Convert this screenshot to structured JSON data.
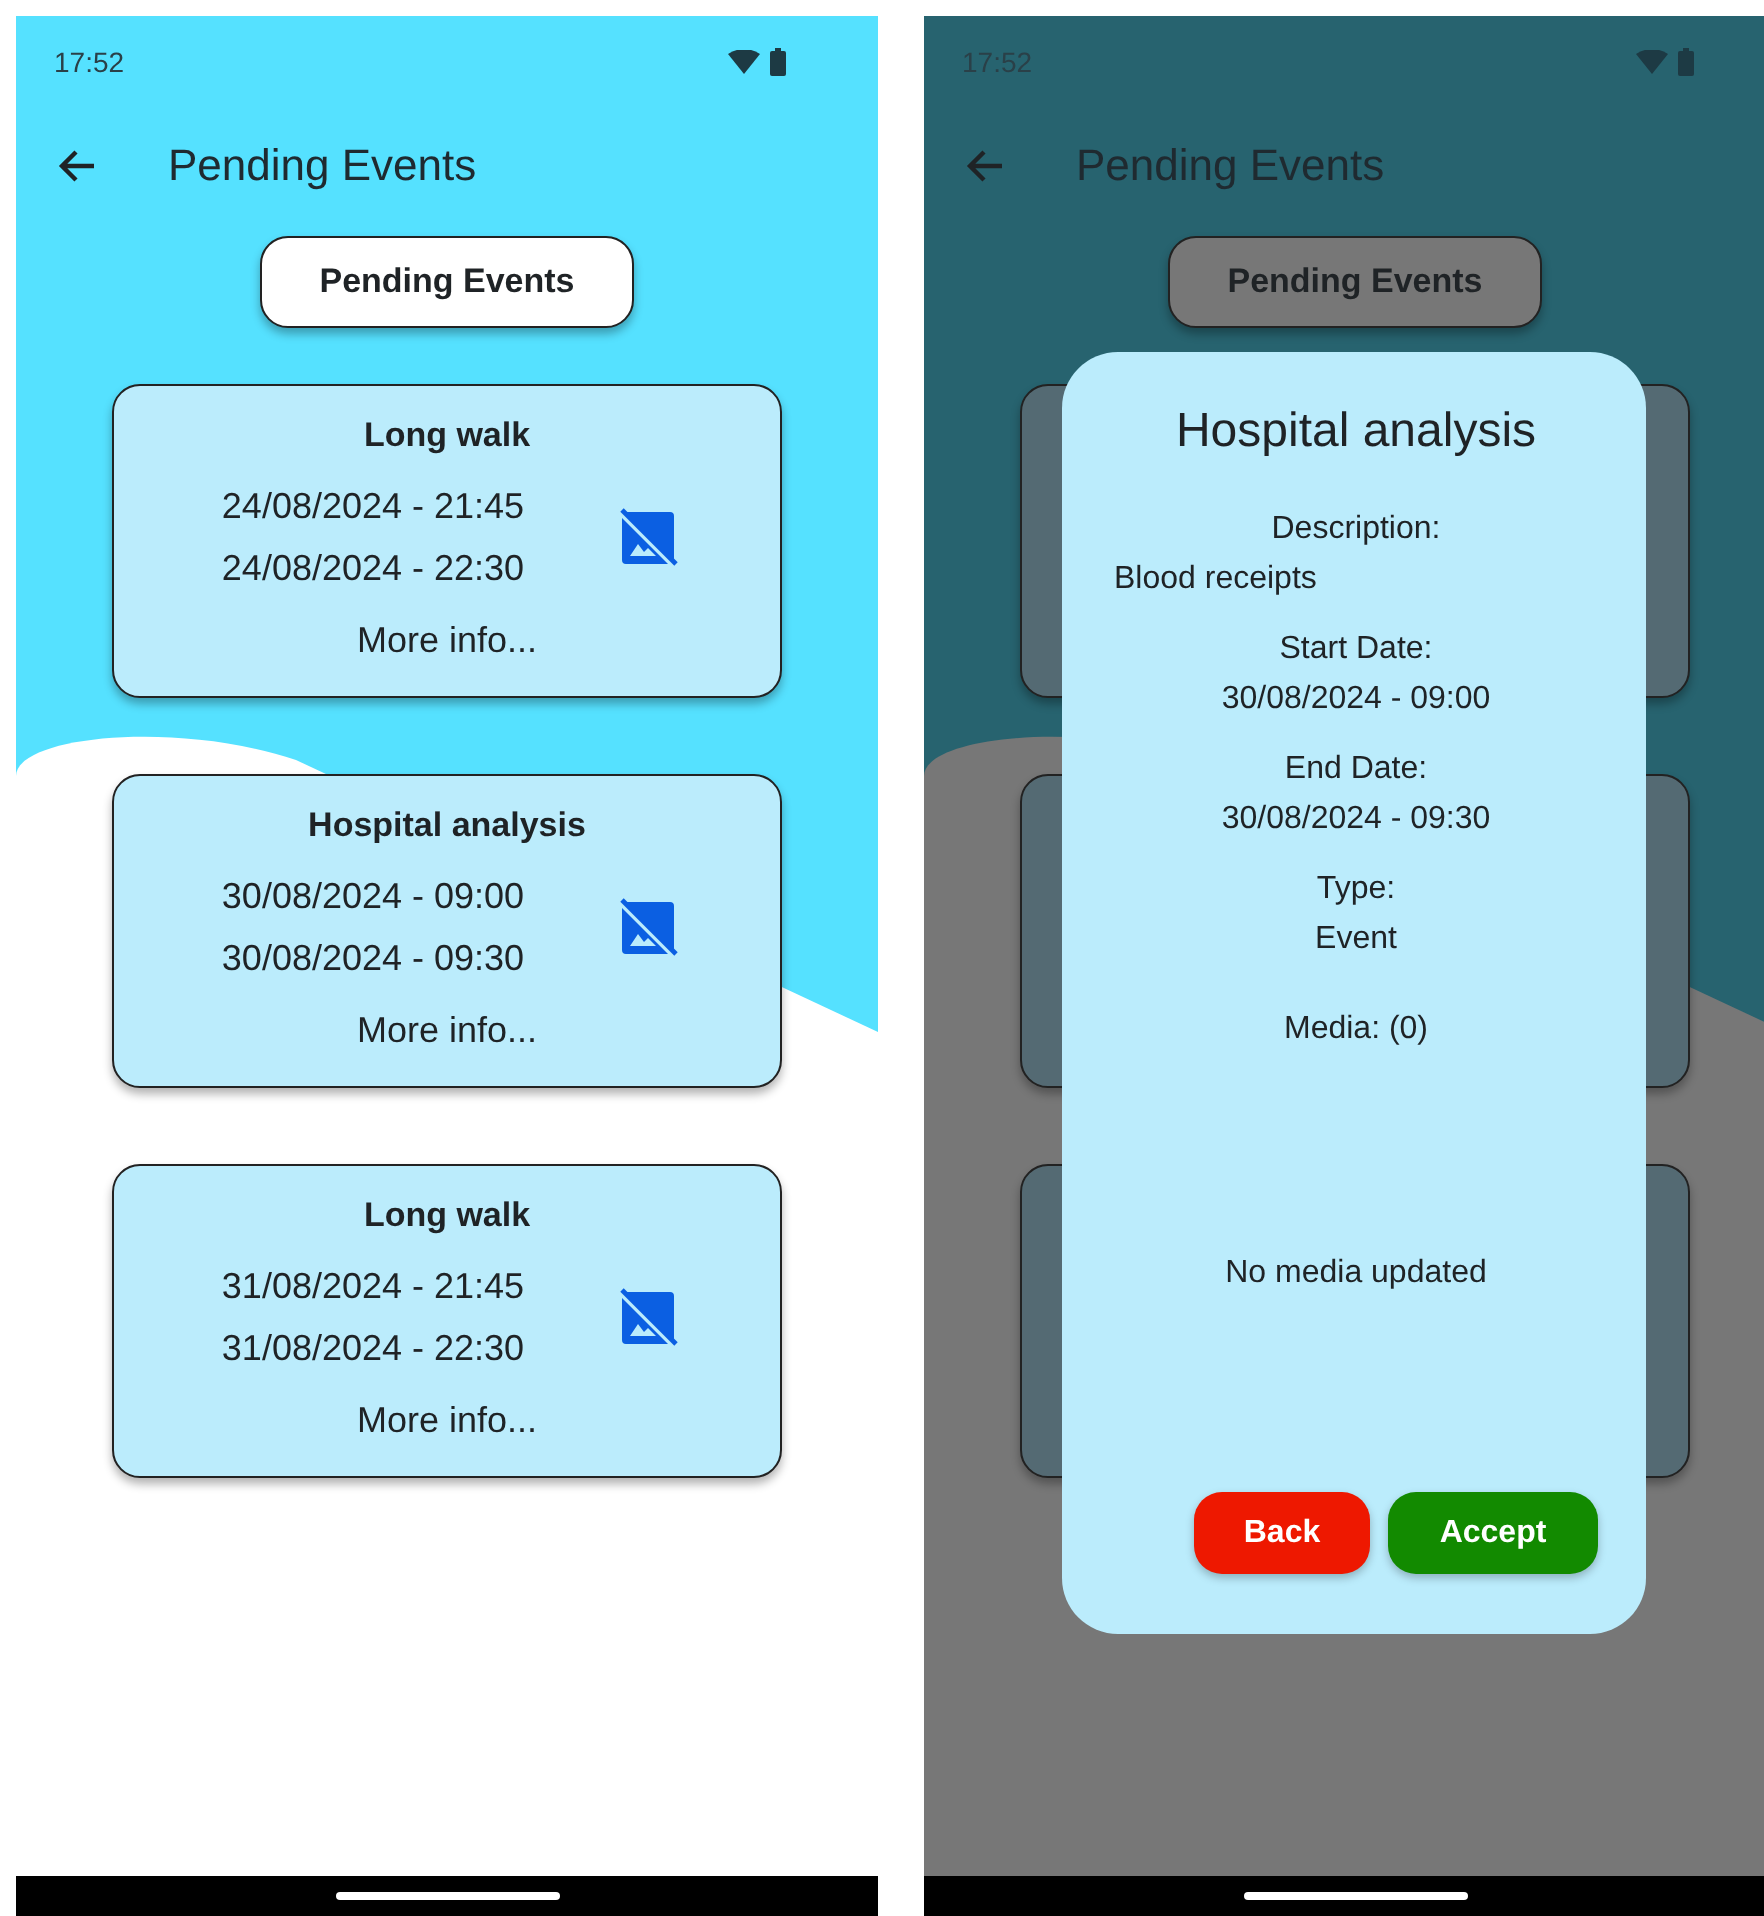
{
  "screens": [
    {
      "kind": "list",
      "status_bar": {
        "time": "17:52"
      },
      "app_bar": {
        "title": "Pending Events"
      },
      "header_button": "Pending Events",
      "events": [
        {
          "title": "Long walk",
          "start": "24/08/2024 - 21:45",
          "end": "24/08/2024 - 22:30",
          "link": "More info..."
        },
        {
          "title": "Hospital analysis",
          "start": "30/08/2024 - 09:00",
          "end": "30/08/2024 - 09:30",
          "link": "More info..."
        },
        {
          "title": "Long walk",
          "start": "31/08/2024 - 21:45",
          "end": "31/08/2024 - 22:30",
          "link": "More info..."
        }
      ]
    },
    {
      "kind": "dialog",
      "status_bar": {
        "time": "17:52"
      },
      "app_bar": {
        "title": "Pending Events"
      },
      "header_button": "Pending Events",
      "dialog": {
        "title": "Hospital analysis",
        "fields": [
          {
            "label": "Description:",
            "value": "Blood receipts",
            "kind": "left"
          },
          {
            "label": "Start Date:",
            "value": "30/08/2024 - 09:00",
            "kind": "center"
          },
          {
            "label": "End Date:",
            "value": "30/08/2024 - 09:30",
            "kind": "center"
          },
          {
            "label": "Type:",
            "value": "Event",
            "kind": "center"
          }
        ],
        "media": "Media: (0)",
        "empty_message": "No media updated",
        "buttons": [
          {
            "label": "Back",
            "kind": "cancel"
          },
          {
            "label": "Accept",
            "kind": "confirm"
          }
        ]
      }
    }
  ]
}
